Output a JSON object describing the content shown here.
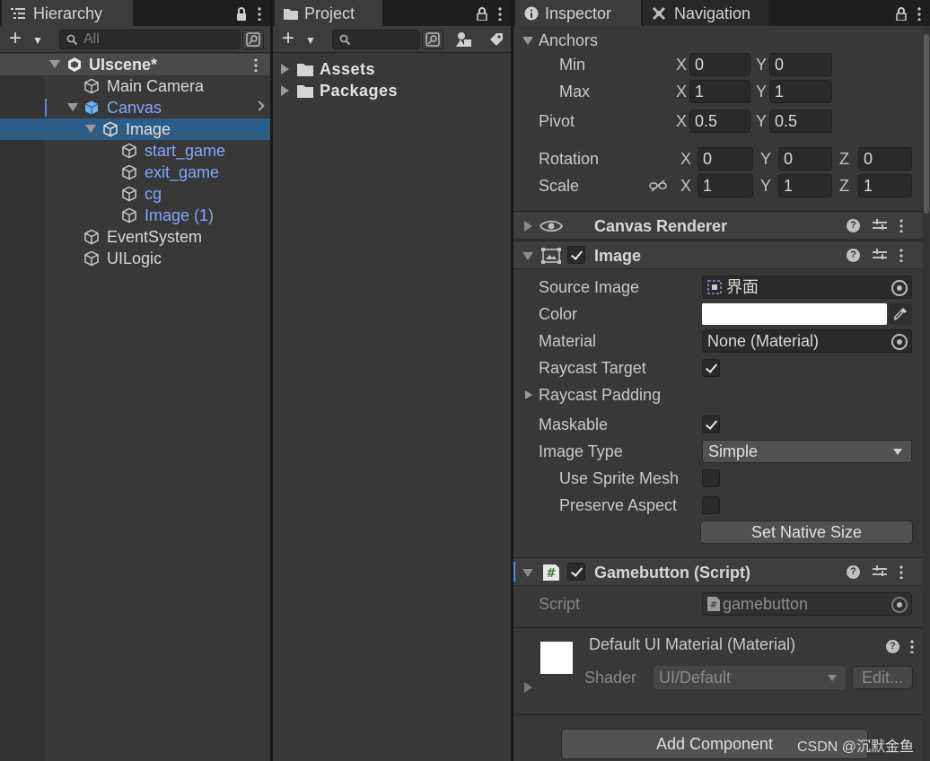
{
  "hierarchy": {
    "tab_label": "Hierarchy",
    "search_placeholder": "All",
    "scene_name": "UIscene*",
    "items": [
      {
        "label": "Main Camera"
      },
      {
        "label": "Canvas"
      },
      {
        "label": "Image"
      },
      {
        "label": "start_game"
      },
      {
        "label": "exit_game"
      },
      {
        "label": "cg"
      },
      {
        "label": "Image (1)"
      },
      {
        "label": "EventSystem"
      },
      {
        "label": "UILogic"
      }
    ]
  },
  "project": {
    "tab_label": "Project",
    "folders": [
      {
        "label": "Assets"
      },
      {
        "label": "Packages"
      }
    ]
  },
  "inspector": {
    "tab_label": "Inspector",
    "nav_tab_label": "Navigation",
    "anchors": {
      "label": "Anchors",
      "min_label": "Min",
      "min_x": "0",
      "min_y": "0",
      "max_label": "Max",
      "max_x": "1",
      "max_y": "1"
    },
    "pivot": {
      "label": "Pivot",
      "x": "0.5",
      "y": "0.5"
    },
    "rotation": {
      "label": "Rotation",
      "x": "0",
      "y": "0",
      "z": "0"
    },
    "scale": {
      "label": "Scale",
      "x": "1",
      "y": "1",
      "z": "1"
    },
    "axis_labels": {
      "x": "X",
      "y": "Y",
      "z": "Z"
    },
    "canvas_renderer": {
      "title": "Canvas Renderer"
    },
    "image": {
      "title": "Image",
      "source_image_label": "Source Image",
      "source_image_value": "界面",
      "color_label": "Color",
      "material_label": "Material",
      "material_value": "None (Material)",
      "raycast_target_label": "Raycast Target",
      "raycast_padding_label": "Raycast Padding",
      "maskable_label": "Maskable",
      "image_type_label": "Image Type",
      "image_type_value": "Simple",
      "use_sprite_mesh_label": "Use Sprite Mesh",
      "preserve_aspect_label": "Preserve Aspect",
      "set_native_size_label": "Set Native Size"
    },
    "gamebutton": {
      "title": "Gamebutton (Script)",
      "script_label": "Script",
      "script_value": "gamebutton"
    },
    "material_preview": {
      "title": "Default UI Material (Material)",
      "shader_label": "Shader",
      "shader_value": "UI/Default",
      "edit_label": "Edit..."
    },
    "add_component_label": "Add Component"
  },
  "watermark": "CSDN @沉默金鱼"
}
